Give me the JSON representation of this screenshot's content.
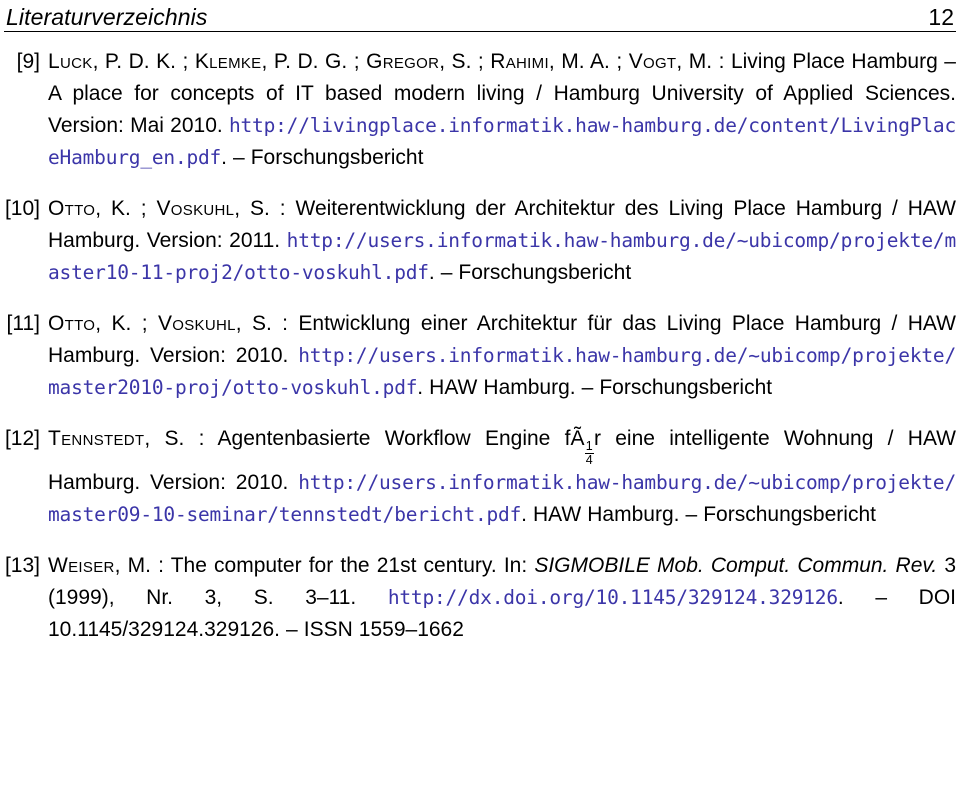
{
  "header": {
    "title": "Literaturverzeichnis",
    "page_number": "12"
  },
  "bibliography": {
    "entries": [
      {
        "label": "[9]",
        "segments": [
          {
            "type": "smallcaps",
            "text": "Luck"
          },
          {
            "type": "text",
            "text": ", P. D. K. ; "
          },
          {
            "type": "smallcaps",
            "text": "Klemke"
          },
          {
            "type": "text",
            "text": ", P. D. G. ; "
          },
          {
            "type": "smallcaps",
            "text": "Gregor"
          },
          {
            "type": "text",
            "text": ", S. ; "
          },
          {
            "type": "smallcaps",
            "text": "Rahimi"
          },
          {
            "type": "text",
            "text": ", M. A. ; "
          },
          {
            "type": "smallcaps",
            "text": "Vogt"
          },
          {
            "type": "text",
            "text": ", M. : Living Place Hamburg – A place for concepts of IT based modern living / Hamburg University of Applied Sciences. Version: Mai 2010. "
          },
          {
            "type": "url",
            "text": "http://livingplace.informatik.haw-hamburg.de/content/LivingPlaceHamburg_en.pdf"
          },
          {
            "type": "text",
            "text": ". – Forschungsbericht"
          }
        ]
      },
      {
        "label": "[10]",
        "segments": [
          {
            "type": "smallcaps",
            "text": "Otto"
          },
          {
            "type": "text",
            "text": ", K. ; "
          },
          {
            "type": "smallcaps",
            "text": "Voskuhl"
          },
          {
            "type": "text",
            "text": ", S. : Weiterentwicklung der Architektur des Living Place Hamburg / HAW Hamburg. Version: 2011. "
          },
          {
            "type": "url",
            "text": "http://users.informatik.haw-hamburg.de/~ubicomp/projekte/master10-11-proj2/otto-voskuhl.pdf"
          },
          {
            "type": "text",
            "text": ". – Forschungsbericht"
          }
        ]
      },
      {
        "label": "[11]",
        "segments": [
          {
            "type": "smallcaps",
            "text": "Otto"
          },
          {
            "type": "text",
            "text": ", K. ; "
          },
          {
            "type": "smallcaps",
            "text": "Voskuhl"
          },
          {
            "type": "text",
            "text": ", S. : Entwicklung einer Architektur für das Living Place Hamburg / HAW Hamburg. Version: 2010. "
          },
          {
            "type": "url",
            "text": "http://users.informatik.haw-hamburg.de/~ubicomp/projekte/master2010-proj/otto-voskuhl.pdf"
          },
          {
            "type": "text",
            "text": ". HAW Hamburg. – Forschungsbericht"
          }
        ]
      },
      {
        "label": "[12]",
        "segments": [
          {
            "type": "smallcaps",
            "text": "Tennstedt"
          },
          {
            "type": "text",
            "text": ", S. : Agentenbasierte Workflow Engine fÃ"
          },
          {
            "type": "fraction",
            "numerator": "1",
            "denominator": "4"
          },
          {
            "type": "text",
            "text": "r eine intelligente Wohnung / HAW Hamburg. Version: 2010. "
          },
          {
            "type": "url",
            "text": "http://users.informatik.haw-hamburg.de/~ubicomp/projekte/master09-10-seminar/tennstedt/bericht.pdf"
          },
          {
            "type": "text",
            "text": ". HAW Hamburg. – Forschungsbericht"
          }
        ]
      },
      {
        "label": "[13]",
        "segments": [
          {
            "type": "smallcaps",
            "text": "Weiser"
          },
          {
            "type": "text",
            "text": ", M. : The computer for the 21st century. In: "
          },
          {
            "type": "italic",
            "text": "SIGMOBILE Mob. Comput. Commun. Rev."
          },
          {
            "type": "text",
            "text": " 3 (1999), Nr. 3, S. 3–11. "
          },
          {
            "type": "url",
            "text": "http://dx.doi.org/10.1145/329124.329126"
          },
          {
            "type": "text",
            "text": ". – DOI 10.1145/329124.329126. – ISSN 1559–1662"
          }
        ]
      }
    ]
  },
  "colors": {
    "url_link": "#3b35a8",
    "text": "#000000",
    "background": "#ffffff"
  }
}
